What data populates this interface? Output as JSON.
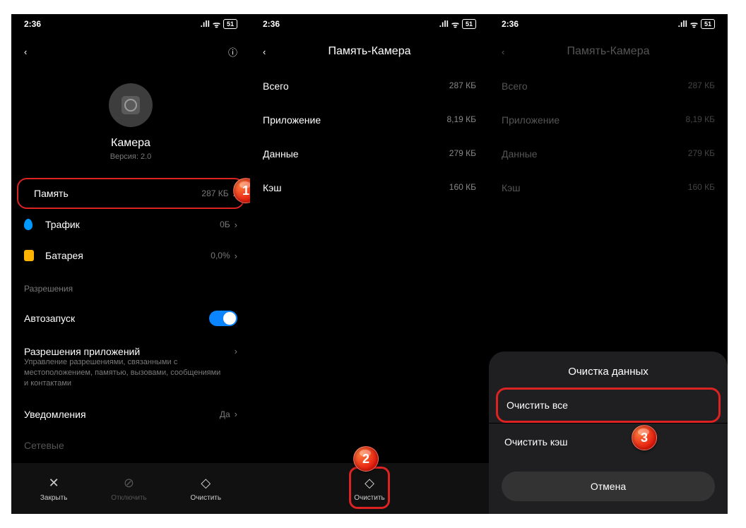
{
  "status": {
    "time": "2:36",
    "battery": "51"
  },
  "screen1": {
    "app_name": "Камера",
    "version": "Версия: 2.0",
    "rows": {
      "memory": {
        "label": "Память",
        "value": "287 КБ"
      },
      "traffic": {
        "label": "Трафик",
        "value": "0Б"
      },
      "battery": {
        "label": "Батарея",
        "value": "0,0%"
      }
    },
    "permissions_title": "Разрешения",
    "autostart": "Автозапуск",
    "app_perms_title": "Разрешения приложений",
    "app_perms_sub": "Управление разрешениями, связанными с местоположением, памятью, вызовами, сообщениями и контактами",
    "notifications": {
      "label": "Уведомления",
      "value": "Да"
    },
    "network_label": "Сетевые",
    "bottom": {
      "close": "Закрыть",
      "disable": "Отключить",
      "clear": "Очистить"
    }
  },
  "screen2": {
    "title": "Память-Камера",
    "rows": {
      "total": {
        "label": "Всего",
        "value": "287 КБ"
      },
      "app": {
        "label": "Приложение",
        "value": "8,19 КБ"
      },
      "data": {
        "label": "Данные",
        "value": "279 КБ"
      },
      "cache": {
        "label": "Кэш",
        "value": "160 КБ"
      }
    },
    "bottom_clear": "Очистить"
  },
  "screen3": {
    "title": "Память-Камера",
    "rows": {
      "total": {
        "label": "Всего",
        "value": "287 КБ"
      },
      "app": {
        "label": "Приложение",
        "value": "8,19 КБ"
      },
      "data": {
        "label": "Данные",
        "value": "279 КБ"
      },
      "cache": {
        "label": "Кэш",
        "value": "160 КБ"
      }
    },
    "sheet": {
      "title": "Очистка данных",
      "clear_all": "Очистить все",
      "clear_cache": "Очистить кэш",
      "cancel": "Отмена"
    }
  },
  "badges": {
    "b1": "1",
    "b2": "2",
    "b3": "3"
  }
}
